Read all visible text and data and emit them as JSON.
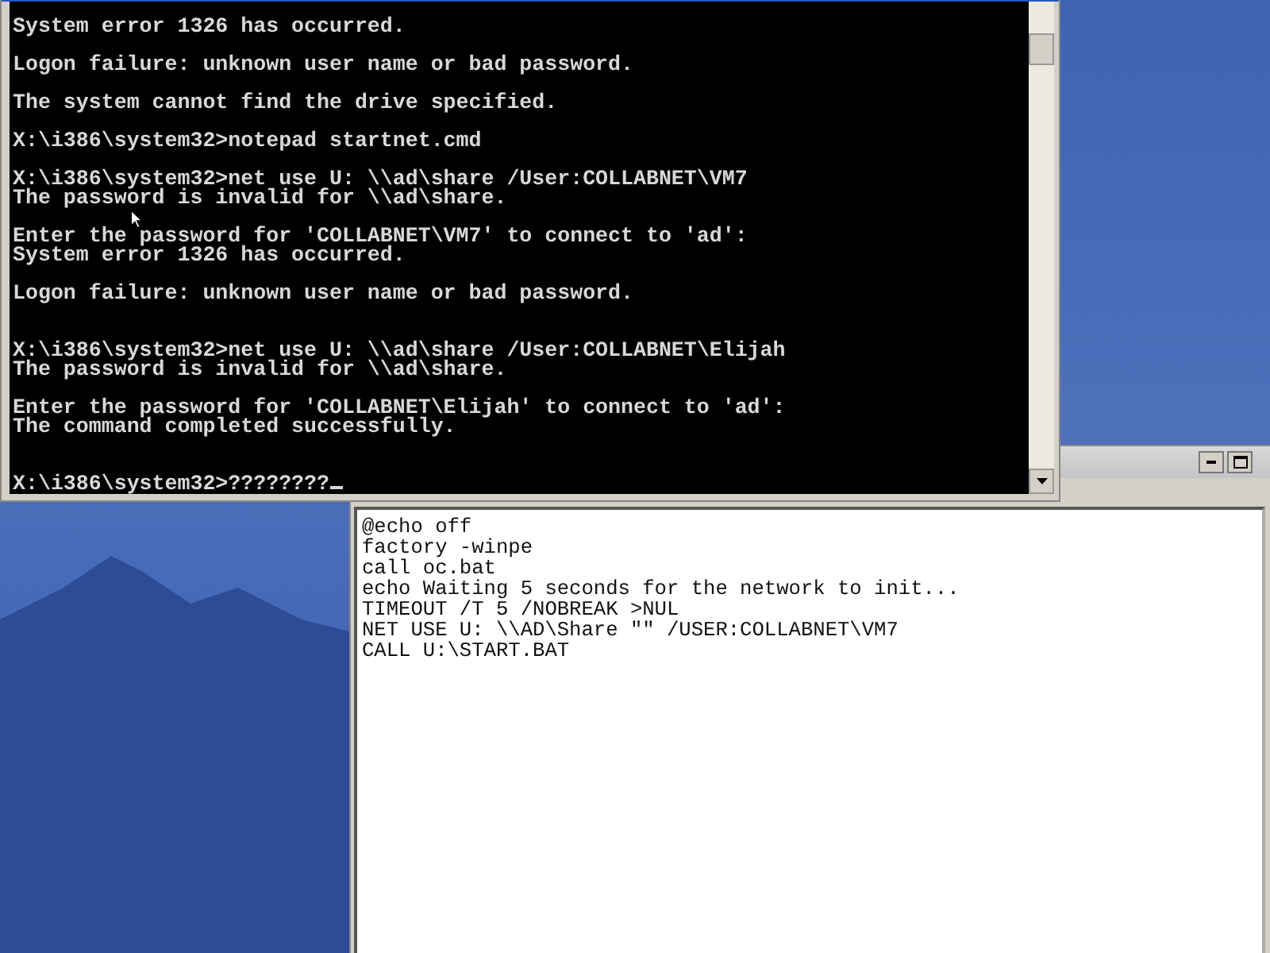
{
  "console": {
    "blocks": [
      {
        "wide_gap_before": false,
        "lines": [
          "System error 1326 has occurred."
        ]
      },
      {
        "wide_gap_before": false,
        "lines": [
          "Logon failure: unknown user name or bad password."
        ]
      },
      {
        "wide_gap_before": false,
        "lines": [
          "The system cannot find the drive specified."
        ]
      },
      {
        "wide_gap_before": false,
        "lines": [
          "X:\\i386\\system32>notepad startnet.cmd"
        ]
      },
      {
        "wide_gap_before": false,
        "lines": [
          "X:\\i386\\system32>net use U: \\\\ad\\share /User:COLLABNET\\VM7",
          "The password is invalid for \\\\ad\\share."
        ]
      },
      {
        "wide_gap_before": false,
        "lines": [
          "Enter the password for 'COLLABNET\\VM7' to connect to 'ad':",
          "System error 1326 has occurred."
        ]
      },
      {
        "wide_gap_before": false,
        "lines": [
          "Logon failure: unknown user name or bad password."
        ]
      },
      {
        "wide_gap_before": true,
        "lines": [
          "X:\\i386\\system32>net use U: \\\\ad\\share /User:COLLABNET\\Elijah",
          "The password is invalid for \\\\ad\\share."
        ]
      },
      {
        "wide_gap_before": false,
        "lines": [
          "Enter the password for 'COLLABNET\\Elijah' to connect to 'ad':",
          "The command completed successfully."
        ]
      },
      {
        "wide_gap_before": true,
        "lines": [
          "X:\\i386\\system32>????????"
        ]
      }
    ],
    "cursor_visible": true
  },
  "notepad": {
    "lines": [
      "@echo off",
      "factory -winpe",
      "call oc.bat",
      "echo Waiting 5 seconds for the network to init...",
      "TIMEOUT /T 5 /NOBREAK >NUL",
      "NET USE U: \\\\AD\\Share \"\" /USER:COLLABNET\\VM7",
      "CALL U:\\START.BAT"
    ]
  }
}
